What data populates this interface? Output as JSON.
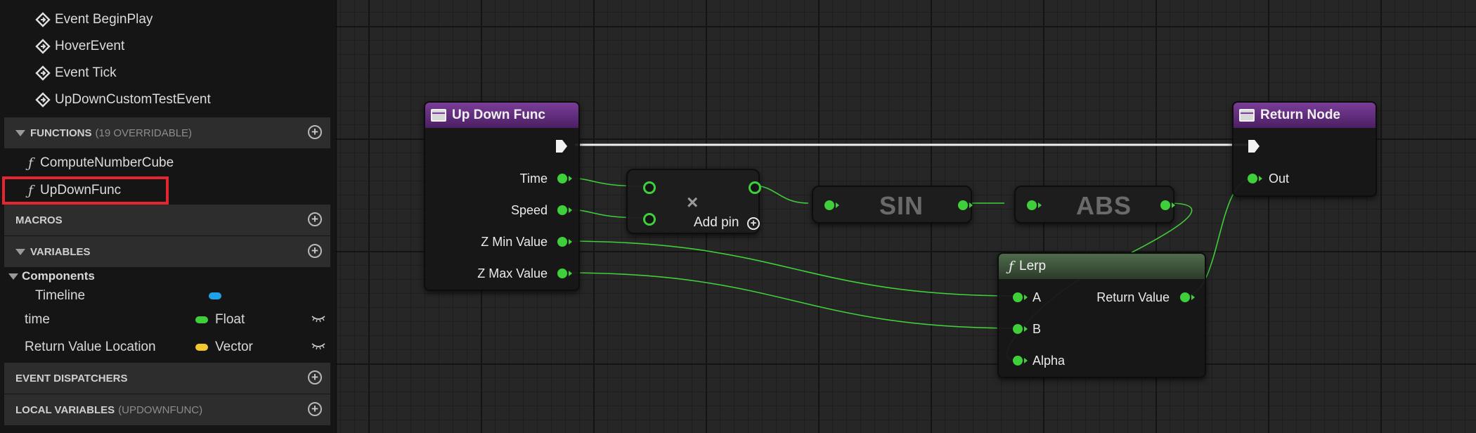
{
  "sidebar": {
    "events": [
      "Event BeginPlay",
      "HoverEvent",
      "Event Tick",
      "UpDownCustomTestEvent"
    ],
    "functions_section": {
      "title": "FUNCTIONS",
      "sub": "(19 OVERRIDABLE)"
    },
    "functions": [
      "ComputeNumberCube",
      "UpDownFunc"
    ],
    "selected_function": "UpDownFunc",
    "macros_section": {
      "title": "MACROS"
    },
    "variables_section": {
      "title": "VARIABLES"
    },
    "components_label": "Components",
    "variables": [
      {
        "name": "Timeline",
        "type": "",
        "color": "#1fa2e6"
      },
      {
        "name": "time",
        "type": "Float",
        "color": "#3fcf3a"
      },
      {
        "name": "Return Value Location",
        "type": "Vector",
        "color": "#f2c82f"
      }
    ],
    "dispatchers_section": {
      "title": "EVENT DISPATCHERS"
    },
    "local_vars_section": {
      "title": "LOCAL VARIABLES",
      "sub": "(UPDOWNFUNC)"
    },
    "function_glyph": "ƒ"
  },
  "graph": {
    "entry_node": {
      "title": "Up Down Func",
      "pins": [
        "Time",
        "Speed",
        "Z Min Value",
        "Z Max Value"
      ]
    },
    "return_node": {
      "title": "Return Node",
      "pins": [
        "Out"
      ]
    },
    "multiply_node": {
      "symbol": "×",
      "add_pin_label": "Add pin"
    },
    "sin_node": {
      "label": "SIN"
    },
    "abs_node": {
      "label": "ABS"
    },
    "lerp_node": {
      "title": "Lerp",
      "inputs": [
        "A",
        "B",
        "Alpha"
      ],
      "output": "Return Value"
    }
  },
  "colors": {
    "float_pin": "#3fcf3a",
    "pure_function_header": "#7a3d98",
    "highlight_box": "#e3262f"
  }
}
